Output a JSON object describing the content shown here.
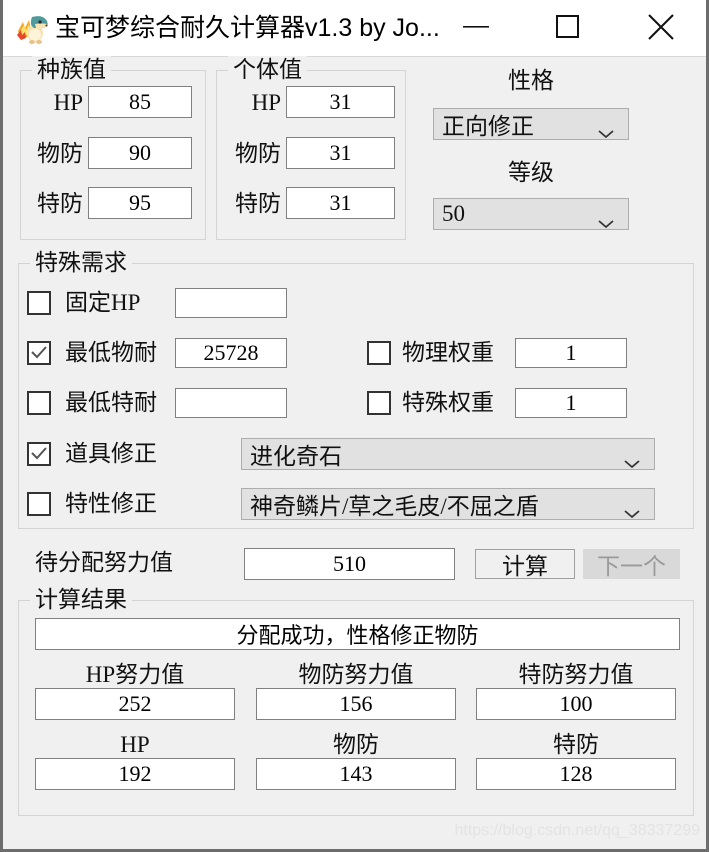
{
  "window": {
    "title": "宝可梦综合耐久计算器v1.3 by Jo...",
    "icon": "cyndaquil-sprite-icon",
    "controls": {
      "minimize": "minimize-icon",
      "maximize": "maximize-icon",
      "close": "close-icon"
    }
  },
  "base_stats": {
    "group_title": "种族值",
    "rows": [
      {
        "label": "HP",
        "value": "85"
      },
      {
        "label": "物防",
        "value": "90"
      },
      {
        "label": "特防",
        "value": "95"
      }
    ]
  },
  "ivs": {
    "group_title": "个体值",
    "rows": [
      {
        "label": "HP",
        "value": "31"
      },
      {
        "label": "物防",
        "value": "31"
      },
      {
        "label": "特防",
        "value": "31"
      }
    ]
  },
  "nature": {
    "label": "性格",
    "selected": "正向修正"
  },
  "level": {
    "label": "等级",
    "selected": "50"
  },
  "special_requirements": {
    "group_title": "特殊需求",
    "fixed_hp": {
      "label": "固定HP",
      "checked": false,
      "value": ""
    },
    "min_phys_bulk": {
      "label": "最低物耐",
      "checked": true,
      "value": "25728"
    },
    "min_spec_bulk": {
      "label": "最低特耐",
      "checked": false,
      "value": ""
    },
    "phys_weight": {
      "label": "物理权重",
      "checked": false,
      "value": "1"
    },
    "spec_weight": {
      "label": "特殊权重",
      "checked": false,
      "value": "1"
    },
    "item_mod": {
      "label": "道具修正",
      "checked": true,
      "selected": "进化奇石"
    },
    "ability_mod": {
      "label": "特性修正",
      "checked": false,
      "selected": "神奇鳞片/草之毛皮/不屈之盾"
    }
  },
  "ev_pool": {
    "label": "待分配努力值",
    "value": "510",
    "calculate_button": "计算",
    "next_button": "下一个"
  },
  "results": {
    "group_title": "计算结果",
    "status": "分配成功，性格修正物防",
    "ev_columns": [
      {
        "label": "HP努力值",
        "value": "252"
      },
      {
        "label": "物防努力值",
        "value": "156"
      },
      {
        "label": "特防努力值",
        "value": "100"
      }
    ],
    "stat_columns": [
      {
        "label": "HP",
        "value": "192"
      },
      {
        "label": "物防",
        "value": "143"
      },
      {
        "label": "特防",
        "value": "128"
      }
    ]
  },
  "watermark": "https://blog.csdn.net/qq_38337299"
}
